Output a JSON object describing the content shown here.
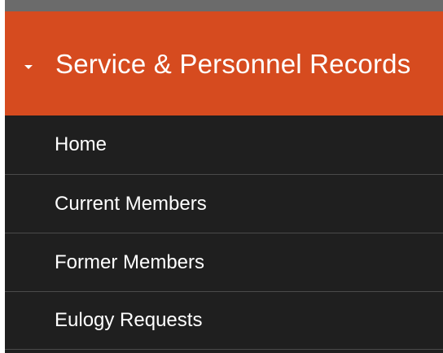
{
  "nav": {
    "section": {
      "title": "Service & Personnel Records",
      "expanded": true,
      "accent_color": "#d64b1f",
      "icon": "caret-down-icon"
    },
    "items": [
      {
        "label": "Home"
      },
      {
        "label": "Current Members"
      },
      {
        "label": "Former Members"
      },
      {
        "label": "Eulogy Requests"
      }
    ]
  }
}
